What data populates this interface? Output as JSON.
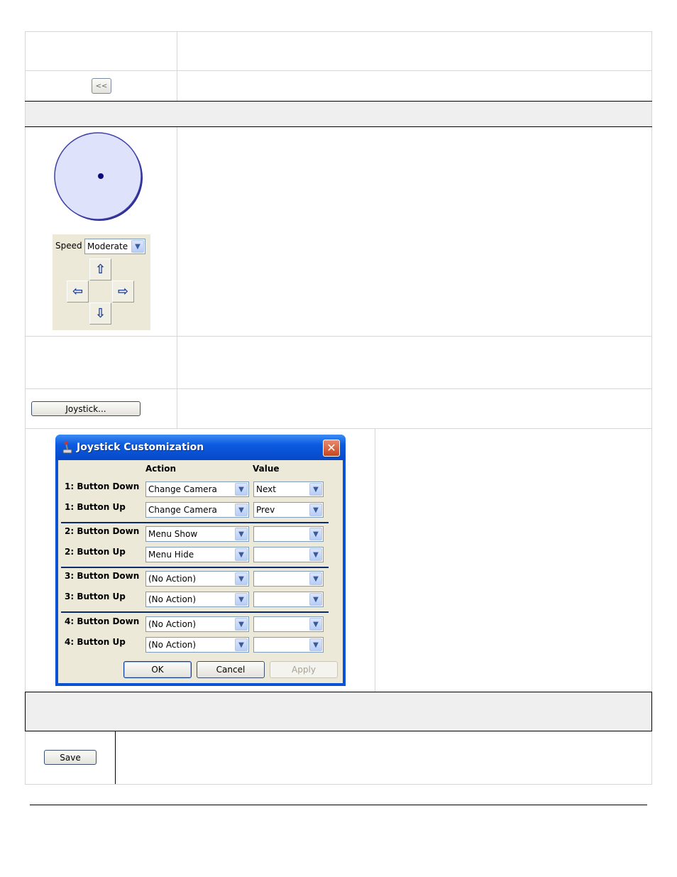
{
  "nav": {
    "back_label": "<<"
  },
  "ptz": {
    "speed_label": "Speed",
    "speed_value": "Moderate",
    "arrows": {
      "up": "⇧",
      "left": "⇦",
      "right": "⇨",
      "down": "⇩"
    }
  },
  "joystick_button_label": "Joystick...",
  "dialog": {
    "title": "Joystick Customization",
    "close_glyph": "✕",
    "col_action": "Action",
    "col_value": "Value",
    "rows": [
      {
        "label": "1: Button Down",
        "action": "Change Camera",
        "value": "Next"
      },
      {
        "label": "1: Button Up",
        "action": "Change Camera",
        "value": "Prev"
      },
      {
        "label": "2: Button Down",
        "action": "Menu Show",
        "value": ""
      },
      {
        "label": "2: Button Up",
        "action": "Menu Hide",
        "value": ""
      },
      {
        "label": "3: Button Down",
        "action": "(No Action)",
        "value": ""
      },
      {
        "label": "3: Button Up",
        "action": "(No Action)",
        "value": ""
      },
      {
        "label": "4: Button Down",
        "action": "(No Action)",
        "value": ""
      },
      {
        "label": "4: Button Up",
        "action": "(No Action)",
        "value": ""
      }
    ],
    "ok_label": "OK",
    "cancel_label": "Cancel",
    "apply_label": "Apply",
    "dropdown_glyph": "▼"
  },
  "save_label": "Save",
  "colors": {
    "circle_fill": "#dfe2fb",
    "circle_stroke": "#3d3fa8",
    "dialog_blue": "#0a52d4"
  }
}
